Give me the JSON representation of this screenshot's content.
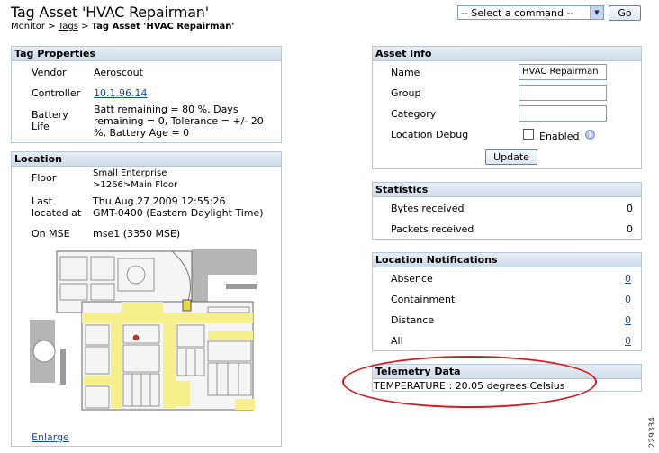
{
  "page": {
    "title": "Tag Asset 'HVAC Repairman'",
    "breadcrumb": {
      "root": "Monitor",
      "sep1": " > ",
      "tags": "Tags",
      "sep2": " > ",
      "current": "Tag Asset 'HVAC Repairman'"
    }
  },
  "command": {
    "selected": "-- Select a command --",
    "go": "Go"
  },
  "tag_properties": {
    "header": "Tag Properties",
    "vendor_label": "Vendor",
    "vendor": "Aeroscout",
    "controller_label": "Controller",
    "controller": "10.1.96.14",
    "battery_label_1": "Battery",
    "battery_label_2": "Life",
    "battery_1": "Batt remaining = 80 %, Days",
    "battery_2": "remaining = 0, Tolerance = +/- 20",
    "battery_3": "%, Battery Age = 0"
  },
  "location": {
    "header": "Location",
    "floor_label": "Floor",
    "floor_1": "Small Enterprise",
    "floor_2": ">1266>Main Floor",
    "last_label_1": "Last",
    "last_label_2": "located at",
    "last_1": "Thu Aug 27 2009 12:55:26",
    "last_2": "GMT-0400 (Eastern Daylight Time)",
    "mse_label": "On MSE",
    "mse": "mse1  (3350 MSE)",
    "enlarge": "Enlarge"
  },
  "asset_info": {
    "header": "Asset Info",
    "name_label": "Name",
    "name": "HVAC Repairman",
    "group_label": "Group",
    "group": "",
    "category_label": "Category",
    "category": "",
    "debug_label": "Location Debug",
    "enabled_label": "Enabled",
    "update": "Update"
  },
  "statistics": {
    "header": "Statistics",
    "bytes_label": "Bytes received",
    "bytes": "0",
    "packets_label": "Packets received",
    "packets": "0"
  },
  "notifications": {
    "header": "Location Notifications",
    "absence_label": "Absence",
    "absence": "0",
    "containment_label": "Containment",
    "containment": "0",
    "distance_label": "Distance",
    "distance": "0",
    "all_label": "All",
    "all": "0"
  },
  "telemetry": {
    "header": "Telemetry Data",
    "reading": "TEMPERATURE : 20.05 degrees Celsius"
  },
  "figure_number": "229334",
  "colors": {
    "panel_header": "#cfdbe8",
    "link": "#1a4f9c",
    "highlight_circle": "#d71920",
    "floor_yellow": "#f7ee8c"
  }
}
